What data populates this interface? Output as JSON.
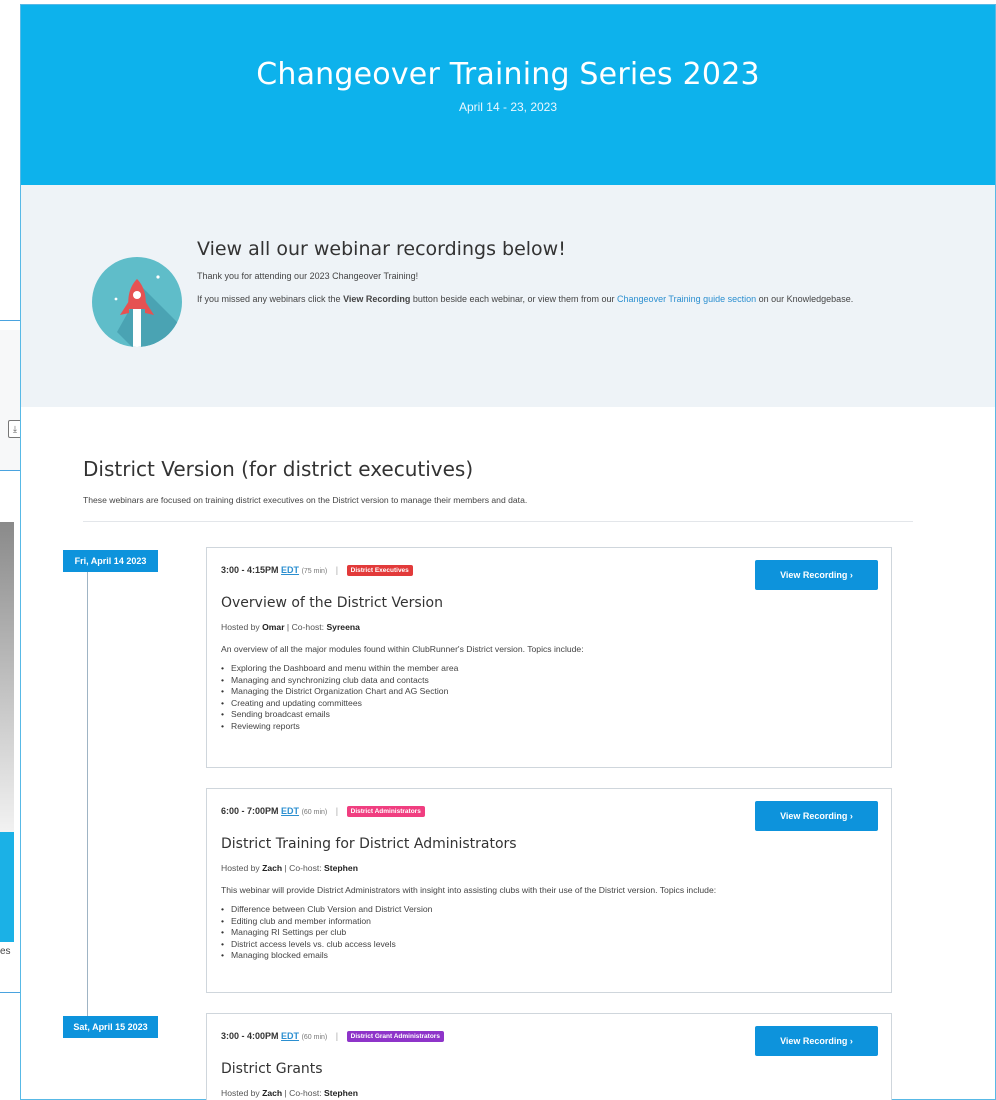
{
  "background": {
    "fragment_text": "es"
  },
  "hero": {
    "title": "Changeover Training Series 2023",
    "dates": "April 14 - 23, 2023"
  },
  "intro": {
    "heading": "View all our webinar recordings below!",
    "thanks": "Thank you for attending our 2023 Changeover Training!",
    "line_a": "If you missed any webinars click the ",
    "line_b": "View Recording",
    "line_c": " button beside each webinar, or view them from our ",
    "link": "Changeover Training guide section",
    "line_d": " on our Knowledgebase."
  },
  "section": {
    "title": "District Version (for district executives)",
    "subtitle": "These webinars are focused on training district executives on the District version to manage their members and data."
  },
  "dates": [
    "Fri, April 14 2023",
    "Sat, April 15 2023"
  ],
  "button_label": "View Recording",
  "hosted_label": "Hosted by",
  "cohost_label": "Co-host:",
  "tz": "EDT",
  "colors": {
    "hero_bg": "#0db2ec",
    "accent": "#0d93dc",
    "badge_exec": "#e23a3a",
    "badge_admin": "#f03e80",
    "badge_grant": "#8e34c9"
  },
  "webinars": [
    {
      "time": "3:00 - 4:15PM",
      "duration": "(75 min)",
      "badge": "District Executives",
      "title": "Overview of the District Version",
      "host": "Omar",
      "cohost": "Syreena",
      "description": "An overview of all the major modules found within ClubRunner's District version. Topics include:",
      "topics": [
        "Exploring the Dashboard and menu within the member area",
        "Managing and synchronizing club data and contacts",
        "Managing the District Organization Chart and AG Section",
        "Creating and updating committees",
        "Sending broadcast emails",
        "Reviewing reports"
      ]
    },
    {
      "time": "6:00 - 7:00PM",
      "duration": "(60 min)",
      "badge": "District Administrators",
      "title": "District Training for District Administrators",
      "host": "Zach",
      "cohost": "Stephen",
      "description": "This webinar will provide District Administrators with insight into assisting clubs with their use of the District version. Topics include:",
      "topics": [
        "Difference between Club Version and District Version",
        "Editing club and member information",
        "Managing RI Settings per club",
        "District access levels vs. club access levels",
        "Managing blocked emails"
      ]
    },
    {
      "time": "3:00 - 4:00PM",
      "duration": "(60 min)",
      "badge": "District Grant Administrators",
      "title": "District Grants",
      "host": "Zach",
      "cohost": "Stephen"
    }
  ]
}
